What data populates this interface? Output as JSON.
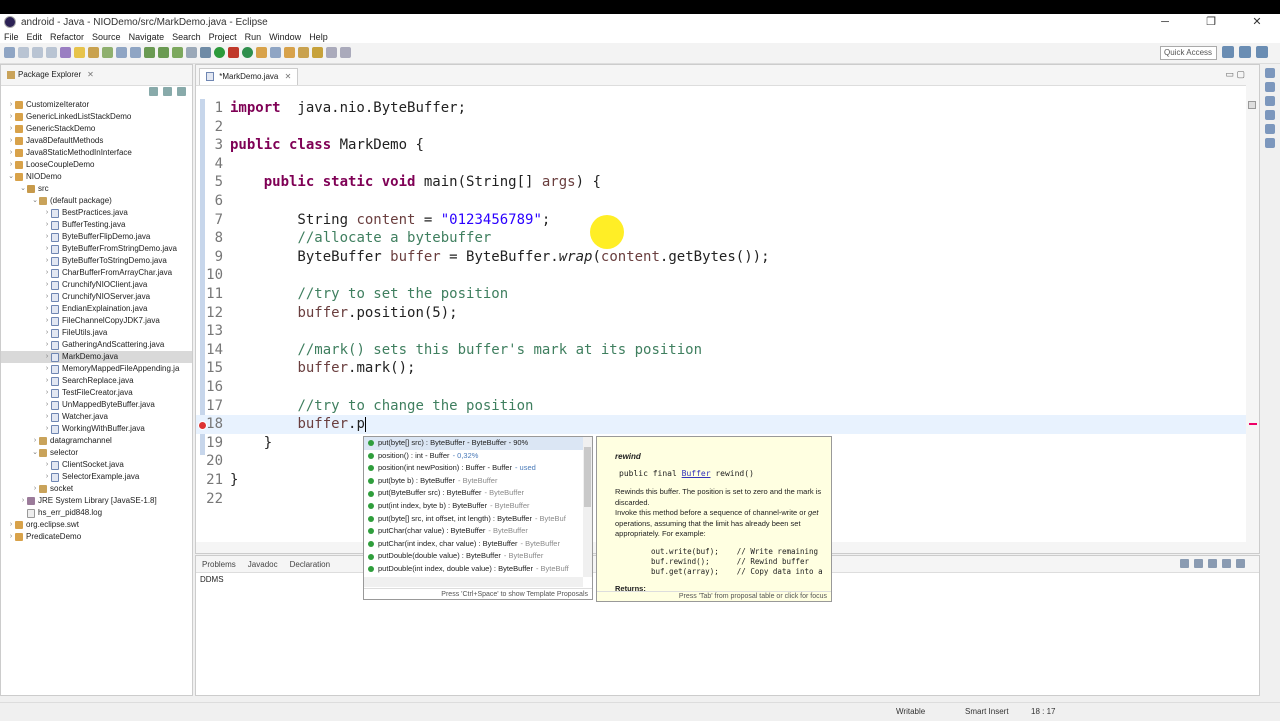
{
  "window": {
    "title": "android - Java - NIODemo/src/MarkDemo.java - Eclipse",
    "controls": [
      "─",
      "❐",
      "✕"
    ]
  },
  "menu": [
    "File",
    "Edit",
    "Refactor",
    "Source",
    "Navigate",
    "Search",
    "Project",
    "Run",
    "Window",
    "Help"
  ],
  "toolbar": {
    "quick_access": "Quick Access"
  },
  "package_explorer": {
    "title": "Package Explorer",
    "items": [
      {
        "label": "CustomizeIterator",
        "depth": 0,
        "type": "proj",
        "tw": "›"
      },
      {
        "label": "GenericLinkedListStackDemo",
        "depth": 0,
        "type": "proj",
        "tw": "›"
      },
      {
        "label": "GenericStackDemo",
        "depth": 0,
        "type": "proj",
        "tw": "›"
      },
      {
        "label": "Java8DefaultMethods",
        "depth": 0,
        "type": "proj",
        "tw": "›"
      },
      {
        "label": "Java8StaticMethodInInterface",
        "depth": 0,
        "type": "proj",
        "tw": "›"
      },
      {
        "label": "LooseCoupleDemo",
        "depth": 0,
        "type": "proj",
        "tw": "›"
      },
      {
        "label": "NIODemo",
        "depth": 0,
        "type": "proj",
        "tw": "⌄"
      },
      {
        "label": "src",
        "depth": 1,
        "type": "src",
        "tw": "⌄"
      },
      {
        "label": "(default package)",
        "depth": 2,
        "type": "pkg",
        "tw": "⌄"
      },
      {
        "label": "BestPractices.java",
        "depth": 3,
        "type": "java",
        "tw": "›"
      },
      {
        "label": "BufferTesting.java",
        "depth": 3,
        "type": "java",
        "tw": "›"
      },
      {
        "label": "ByteBufferFlipDemo.java",
        "depth": 3,
        "type": "java",
        "tw": "›"
      },
      {
        "label": "ByteBufferFromStringDemo.java",
        "depth": 3,
        "type": "java",
        "tw": "›"
      },
      {
        "label": "ByteBufferToStringDemo.java",
        "depth": 3,
        "type": "java",
        "tw": "›"
      },
      {
        "label": "CharBufferFromArrayChar.java",
        "depth": 3,
        "type": "java",
        "tw": "›"
      },
      {
        "label": "CrunchifyNIOClient.java",
        "depth": 3,
        "type": "java",
        "tw": "›"
      },
      {
        "label": "CrunchifyNIOServer.java",
        "depth": 3,
        "type": "java",
        "tw": "›"
      },
      {
        "label": "EndianExplaination.java",
        "depth": 3,
        "type": "java",
        "tw": "›"
      },
      {
        "label": "FileChannelCopyJDK7.java",
        "depth": 3,
        "type": "java",
        "tw": "›"
      },
      {
        "label": "FileUtils.java",
        "depth": 3,
        "type": "java",
        "tw": "›"
      },
      {
        "label": "GatheringAndScattering.java",
        "depth": 3,
        "type": "java",
        "tw": "›"
      },
      {
        "label": "MarkDemo.java",
        "depth": 3,
        "type": "java",
        "tw": "›",
        "selected": true
      },
      {
        "label": "MemoryMappedFileAppending.ja",
        "depth": 3,
        "type": "java",
        "tw": "›"
      },
      {
        "label": "SearchReplace.java",
        "depth": 3,
        "type": "java",
        "tw": "›"
      },
      {
        "label": "TestFileCreator.java",
        "depth": 3,
        "type": "java",
        "tw": "›"
      },
      {
        "label": "UnMappedByteBuffer.java",
        "depth": 3,
        "type": "java",
        "tw": "›"
      },
      {
        "label": "Watcher.java",
        "depth": 3,
        "type": "java",
        "tw": "›"
      },
      {
        "label": "WorkingWithBuffer.java",
        "depth": 3,
        "type": "java",
        "tw": "›"
      },
      {
        "label": "datagramchannel",
        "depth": 2,
        "type": "pkg",
        "tw": "›"
      },
      {
        "label": "selector",
        "depth": 2,
        "type": "pkg",
        "tw": "⌄"
      },
      {
        "label": "ClientSocket.java",
        "depth": 3,
        "type": "java",
        "tw": "›"
      },
      {
        "label": "SelectorExample.java",
        "depth": 3,
        "type": "java",
        "tw": "›"
      },
      {
        "label": "socket",
        "depth": 2,
        "type": "pkg",
        "tw": "›"
      },
      {
        "label": "JRE System Library [JavaSE-1.8]",
        "depth": 1,
        "type": "jre",
        "tw": "›"
      },
      {
        "label": "hs_err_pid848.log",
        "depth": 1,
        "type": "log",
        "tw": ""
      },
      {
        "label": "org.eclipse.swt",
        "depth": 0,
        "type": "proj",
        "tw": "›"
      },
      {
        "label": "PredicateDemo",
        "depth": 0,
        "type": "proj",
        "tw": "›"
      }
    ]
  },
  "editor": {
    "tab_label": "*MarkDemo.java",
    "lines": [
      {
        "n": "1",
        "segs": [
          [
            "kw",
            "import"
          ],
          [
            "",
            "  java.nio.ByteBuffer;"
          ]
        ]
      },
      {
        "n": "2",
        "segs": []
      },
      {
        "n": "3",
        "segs": [
          [
            "kw",
            "public class"
          ],
          [
            "",
            " MarkDemo {"
          ]
        ]
      },
      {
        "n": "4",
        "segs": []
      },
      {
        "n": "5",
        "segs": [
          [
            "",
            "    "
          ],
          [
            "kw",
            "public static void"
          ],
          [
            "",
            " main(String[] "
          ],
          [
            "var",
            "args"
          ],
          [
            "",
            ") {"
          ]
        ]
      },
      {
        "n": "6",
        "segs": []
      },
      {
        "n": "7",
        "segs": [
          [
            "",
            "        String "
          ],
          [
            "var",
            "content"
          ],
          [
            "",
            " = "
          ],
          [
            "str",
            "\"0123456789\""
          ],
          [
            "",
            ";"
          ]
        ]
      },
      {
        "n": "8",
        "segs": [
          [
            "",
            "        "
          ],
          [
            "cm",
            "//allocate a bytebuffer"
          ]
        ]
      },
      {
        "n": "9",
        "segs": [
          [
            "",
            "        ByteBuffer "
          ],
          [
            "var",
            "buffer"
          ],
          [
            "",
            " = ByteBuffer."
          ],
          [
            "it",
            "wrap"
          ],
          [
            "",
            "("
          ],
          [
            "var",
            "content"
          ],
          [
            "",
            ".getBytes());"
          ]
        ]
      },
      {
        "n": "10",
        "segs": []
      },
      {
        "n": "11",
        "segs": [
          [
            "",
            "        "
          ],
          [
            "cm",
            "//try to set the position"
          ]
        ]
      },
      {
        "n": "12",
        "segs": [
          [
            "",
            "        "
          ],
          [
            "var",
            "buffer"
          ],
          [
            "",
            ".position(5);"
          ]
        ]
      },
      {
        "n": "13",
        "segs": []
      },
      {
        "n": "14",
        "segs": [
          [
            "",
            "        "
          ],
          [
            "cm",
            "//mark() sets this buffer's mark at its position"
          ]
        ]
      },
      {
        "n": "15",
        "segs": [
          [
            "",
            "        "
          ],
          [
            "var",
            "buffer"
          ],
          [
            "",
            ".mark();"
          ]
        ]
      },
      {
        "n": "16",
        "segs": []
      },
      {
        "n": "17",
        "segs": [
          [
            "",
            "        "
          ],
          [
            "cm",
            "//try to change the position"
          ]
        ]
      },
      {
        "n": "18",
        "segs": [
          [
            "",
            "        "
          ],
          [
            "var",
            "buffer"
          ],
          [
            "",
            ".p"
          ]
        ],
        "current": true,
        "error": true
      },
      {
        "n": "19",
        "segs": [
          [
            "",
            "    }"
          ]
        ]
      },
      {
        "n": "20",
        "segs": []
      },
      {
        "n": "21",
        "segs": [
          [
            "",
            "}"
          ]
        ]
      },
      {
        "n": "22",
        "segs": []
      }
    ]
  },
  "content_assist": {
    "proposals": [
      {
        "text": "put(byte[] src) : ByteBuffer - ByteBuffer - 90%",
        "qual": "",
        "selected": true
      },
      {
        "text": "position() : int - Buffer",
        "qual": "- 0,32%",
        "blue": true
      },
      {
        "text": "position(int newPosition) : Buffer - Buffer",
        "qual": "- used",
        "blue": true
      },
      {
        "text": "put(byte b) : ByteBuffer",
        "qual": "- ByteBuffer"
      },
      {
        "text": "put(ByteBuffer src) : ByteBuffer",
        "qual": "- ByteBuffer"
      },
      {
        "text": "put(int index, byte b) : ByteBuffer",
        "qual": "- ByteBuffer"
      },
      {
        "text": "put(byte[] src, int offset, int length) : ByteBuffer",
        "qual": "- ByteBuf"
      },
      {
        "text": "putChar(char value) : ByteBuffer",
        "qual": "- ByteBuffer"
      },
      {
        "text": "putChar(int index, char value) : ByteBuffer",
        "qual": "- ByteBuffer"
      },
      {
        "text": "putDouble(double value) : ByteBuffer",
        "qual": "- ByteBuffer"
      },
      {
        "text": "putDouble(int index, double value) : ByteBuffer",
        "qual": "- ByteBuff"
      }
    ],
    "footer": "Press 'Ctrl+Space' to show Template Proposals"
  },
  "javadoc": {
    "name": "rewind",
    "sig_pre": "public final ",
    "sig_link": "Buffer",
    "sig_post": " rewind()",
    "desc1": "Rewinds this buffer. The position is set to zero and the mark is discarded.",
    "desc2_a": "Invoke this method before a sequence of channel-write or ",
    "desc2_b": "get",
    "desc2_c": " operations, assuming that the limit has already been set appropriately. For example:",
    "example": "out.write(buf);    // Write remaining\nbuf.rewind();      // Rewind buffer\nbuf.get(array);    // Copy data into a",
    "returns": "Returns:",
    "footer": "Press 'Tab' from proposal table or click for focus"
  },
  "bottom_tabs": [
    "Problems",
    "Javadoc",
    "Declaration"
  ],
  "bottom_content": "DDMS",
  "status": {
    "writable": "Writable",
    "insert": "Smart Insert",
    "position": "18 : 17"
  }
}
